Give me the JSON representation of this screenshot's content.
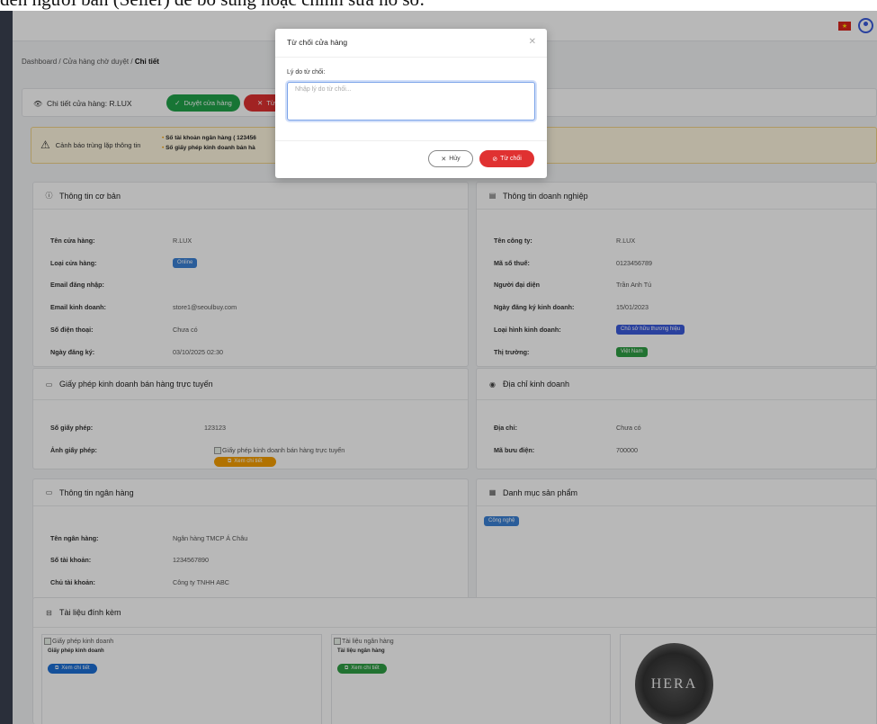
{
  "caption": "đến người bán (Seller) để bổ sung hoặc chỉnh sửa hồ sơ.",
  "breadcrumb": {
    "item1": "Dashboard",
    "sep1": "/",
    "item2": "Cửa hàng chờ duyệt",
    "sep2": "/",
    "current": "Chi tiết"
  },
  "header_card": {
    "title": "Chi tiết cửa hàng: R.LUX",
    "approve_label": "Duyệt cửa hàng",
    "reject_label": "Từ"
  },
  "warning": {
    "title": "Cảnh báo trùng lặp thông tin",
    "line1": "Số tài khoản ngân hàng ( 123456",
    "line2": "Số giấy phép kinh doanh bán hà"
  },
  "basic_info": {
    "title": "Thông tin cơ bản",
    "rows": [
      {
        "label": "Tên cửa hàng:",
        "value": "R.LUX"
      },
      {
        "label": "Loại cửa hàng:",
        "badge": "Online"
      },
      {
        "label": "Email đăng nhập:",
        "value": ""
      },
      {
        "label": "Email kinh doanh:",
        "value": "store1@seoulbuy.com"
      },
      {
        "label": "Số điện thoại:",
        "value": "Chưa có"
      },
      {
        "label": "Ngày đăng ký:",
        "value": "03/10/2025 02:30"
      }
    ]
  },
  "company_info": {
    "title": "Thông tin doanh nghiệp",
    "rows": [
      {
        "label": "Tên công ty:",
        "value": "R.LUX"
      },
      {
        "label": "Mã số thuế:",
        "value": "0123456789"
      },
      {
        "label": "Người đại diện",
        "value": "Trần Anh Tú"
      },
      {
        "label": "Ngày đăng ký kinh doanh:",
        "value": "15/01/2023"
      },
      {
        "label": "Loại hình kinh doanh:",
        "badge": "Chủ sở hữu thương hiệu"
      },
      {
        "label": "Thị trường:",
        "badge": "Việt Nam"
      }
    ]
  },
  "license": {
    "title": "Giấy phép kinh doanh bán hàng trực tuyến",
    "number_label": "Số giấy phép:",
    "number_value": "123123",
    "image_label": "Ảnh giấy phép:",
    "image_alt": "Giấy phép kinh doanh bán hàng trực tuyến",
    "view_label": "Xem chi tiết"
  },
  "address": {
    "title": "Địa chỉ kinh doanh",
    "addr_label": "Địa chỉ:",
    "addr_value": "Chưa có",
    "postal_label": "Mã bưu điện:",
    "postal_value": "700000"
  },
  "bank": {
    "title": "Thông tin ngân hàng",
    "rows": [
      {
        "label": "Tên ngân hàng:",
        "value": "Ngân hàng TMCP Á Châu"
      },
      {
        "label": "Số tài khoản:",
        "value": "1234567890"
      },
      {
        "label": "Chủ tài khoản:",
        "value": "Công ty TNHH ABC"
      }
    ]
  },
  "category": {
    "title": "Danh mục sản phẩm",
    "badge": "Công nghệ"
  },
  "attachments": {
    "title": "Tài liệu đính kèm",
    "doc1_alt": "Giấy phép kinh doanh",
    "doc1_caption": "Giấy phép kinh doanh",
    "doc1_button": "Xem chi tiết",
    "doc2_alt": "Tài liệu ngân hàng",
    "doc2_caption": "Tài liệu ngân hàng",
    "doc2_button": "Xem chi tiết",
    "logo_text": "HERA"
  },
  "modal": {
    "title": "Từ chối cửa hàng",
    "reason_label": "Lý do từ chối:",
    "reason_placeholder": "Nhập lý do từ chối...",
    "cancel_label": "Hủy",
    "reject_label": "Từ chối"
  },
  "colors": {
    "approve": "#20a34a",
    "reject": "#e03131",
    "badge_blue": "#3b82d6",
    "badge_green": "#2f9e44",
    "badge_orange": "#f59f00"
  }
}
